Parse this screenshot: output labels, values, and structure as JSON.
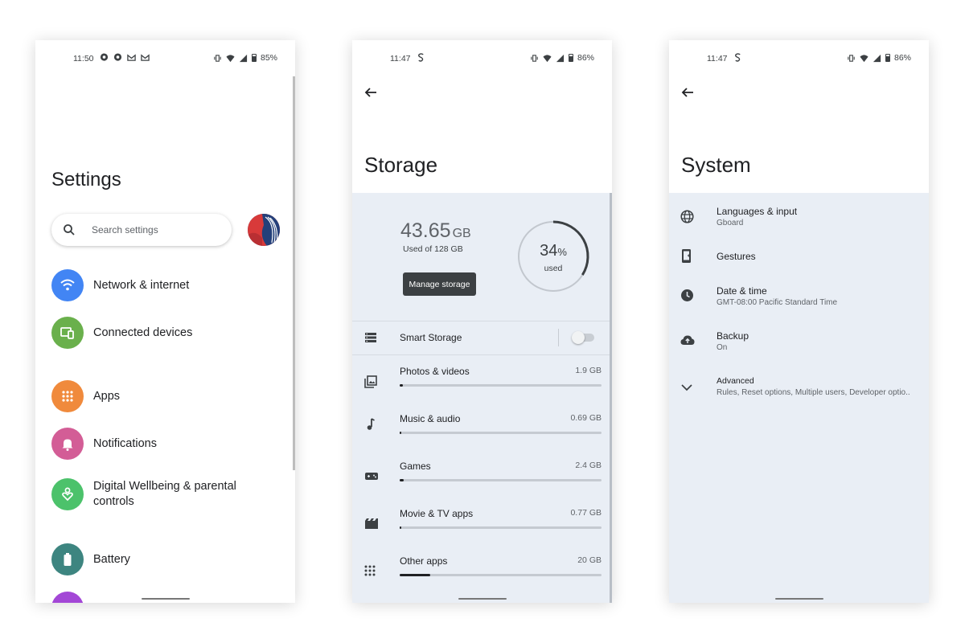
{
  "settings_screen": {
    "status": {
      "time": "11:50",
      "battery": "85%"
    },
    "title": "Settings",
    "search_placeholder": "Search settings",
    "items": [
      {
        "label": "Network & internet",
        "icon": "wifi-icon",
        "color": "#4285f4"
      },
      {
        "label": "Connected devices",
        "icon": "devices-icon",
        "color": "#6ab04c"
      },
      {
        "label": "Apps",
        "icon": "apps-grid-icon",
        "color": "#f08a3c"
      },
      {
        "label": "Notifications",
        "icon": "bell-icon",
        "color": "#d35d96"
      },
      {
        "label": "Digital Wellbeing & parental controls",
        "icon": "wellbeing-icon",
        "color": "#4cc26b"
      },
      {
        "label": "Battery",
        "icon": "battery-icon",
        "color": "#3d8580"
      }
    ]
  },
  "storage_screen": {
    "status": {
      "time": "11:47",
      "battery": "86%"
    },
    "title": "Storage",
    "used_value": "43.65",
    "used_unit": "GB",
    "used_of": "Used of 128 GB",
    "manage_label": "Manage storage",
    "percent": "34",
    "percent_sign": "%",
    "percent_label": "used",
    "percent_fraction": 0.34,
    "smart_storage_label": "Smart Storage",
    "smart_storage_on": false,
    "categories": [
      {
        "label": "Photos & videos",
        "size": "1.9 GB",
        "icon": "photos-icon",
        "fraction": 0.015
      },
      {
        "label": "Music & audio",
        "size": "0.69 GB",
        "icon": "music-note-icon",
        "fraction": 0.005
      },
      {
        "label": "Games",
        "size": "2.4 GB",
        "icon": "gamepad-icon",
        "fraction": 0.018
      },
      {
        "label": "Movie & TV apps",
        "size": "0.77 GB",
        "icon": "movie-icon",
        "fraction": 0.006
      },
      {
        "label": "Other apps",
        "size": "20 GB",
        "icon": "apps-grid-icon",
        "fraction": 0.15
      }
    ]
  },
  "system_screen": {
    "status": {
      "time": "11:47",
      "battery": "86%"
    },
    "title": "System",
    "items": [
      {
        "title": "Languages & input",
        "subtitle": "Gboard",
        "icon": "globe-icon"
      },
      {
        "title": "Gestures",
        "subtitle": "",
        "icon": "gestures-phone-icon"
      },
      {
        "title": "Date & time",
        "subtitle": "GMT-08:00 Pacific Standard Time",
        "icon": "clock-icon"
      },
      {
        "title": "Backup",
        "subtitle": "On",
        "icon": "cloud-upload-icon"
      },
      {
        "title": "Advanced",
        "subtitle": "Rules, Reset options, Multiple users, Developer optio..",
        "icon": "chevron-down-icon"
      }
    ]
  }
}
